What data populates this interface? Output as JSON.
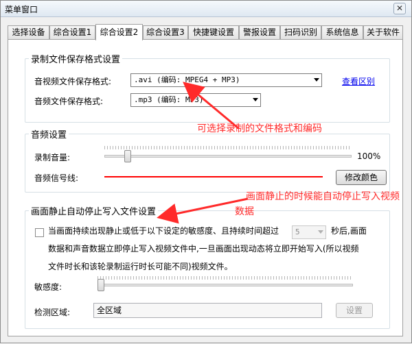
{
  "window": {
    "title": "菜单窗口",
    "close_glyph": "✕"
  },
  "tabs": [
    {
      "label": "选择设备"
    },
    {
      "label": "综合设置1"
    },
    {
      "label": "综合设置2"
    },
    {
      "label": "综合设置3"
    },
    {
      "label": "快捷键设置"
    },
    {
      "label": "警报设置"
    },
    {
      "label": "扫码识别"
    },
    {
      "label": "系统信息"
    },
    {
      "label": "关于软件"
    }
  ],
  "record_format": {
    "title": "录制文件保存格式设置",
    "av_label": "音视频文件保存格式:",
    "av_value": ".avi (编码: MPEG4 + MP3)",
    "audio_label": "音频文件保存格式:",
    "audio_value": ".mp3 (编码: MP3)",
    "link": "查看区别"
  },
  "audio_settings": {
    "title": "音频设置",
    "volume_label": "录制音量:",
    "volume_value": "100%",
    "volume_level": 0.08,
    "signal_label": "音频信号线:",
    "signal_color": "#ff0000",
    "color_button": "修改颜色"
  },
  "auto_stop": {
    "title": "画面静止自动停止写入文件设置",
    "desc_line1": "当画面持续出现静止或低于以下设定的敏感度、且持续时间超过",
    "seconds_value": "5",
    "desc_line1_tail": "秒后,画面",
    "desc_line2": "数据和声音数据立即停止写入视频文件中,一旦画面出现动态将立即开始写入(所以视频",
    "desc_line3": "文件时长和该轮录制运行时长可能不同)视频文件。",
    "sensitivity_label": "敏感度:",
    "sensitivity_level": 0.0,
    "area_label": "检测区域:",
    "area_value": "全区域",
    "area_button": "设置"
  },
  "annotations": {
    "format_note": "可选择录制的文件格式和编码",
    "static_note_line1": "画面静止的时候能自动停止写入视频",
    "static_note_line2": "数据"
  },
  "colors": {
    "annotation": "#ff2a2a",
    "link": "#0000ee"
  },
  "icons": {
    "close": "close-icon",
    "dropdown": "chevron-down-icon",
    "checkbox": "checkbox-icon"
  }
}
